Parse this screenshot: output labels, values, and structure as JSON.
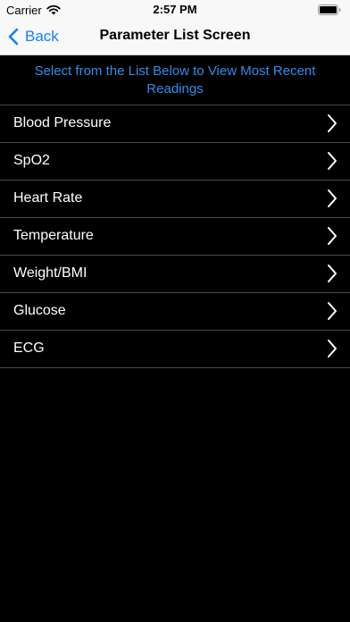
{
  "status_bar": {
    "carrier": "Carrier",
    "time": "2:57 PM",
    "wifi_icon": "wifi-icon",
    "battery_icon": "battery-icon"
  },
  "nav": {
    "back_label": "Back",
    "back_icon": "chevron-left-icon",
    "title": "Parameter List Screen"
  },
  "instruction": "Select from the List Below to View Most Recent Readings",
  "parameters": [
    {
      "label": "Blood Pressure",
      "icon": "chevron-right-icon"
    },
    {
      "label": "SpO2",
      "icon": "chevron-right-icon"
    },
    {
      "label": "Heart Rate",
      "icon": "chevron-right-icon"
    },
    {
      "label": "Temperature",
      "icon": "chevron-right-icon"
    },
    {
      "label": "Weight/BMI",
      "icon": "chevron-right-icon"
    },
    {
      "label": "Glucose",
      "icon": "chevron-right-icon"
    },
    {
      "label": "ECG",
      "icon": "chevron-right-icon"
    }
  ],
  "colors": {
    "accent": "#147efb",
    "instruction_text": "#2f8eea",
    "background": "#000000",
    "row_text": "#ffffff",
    "separator": "#4a4a4a"
  }
}
